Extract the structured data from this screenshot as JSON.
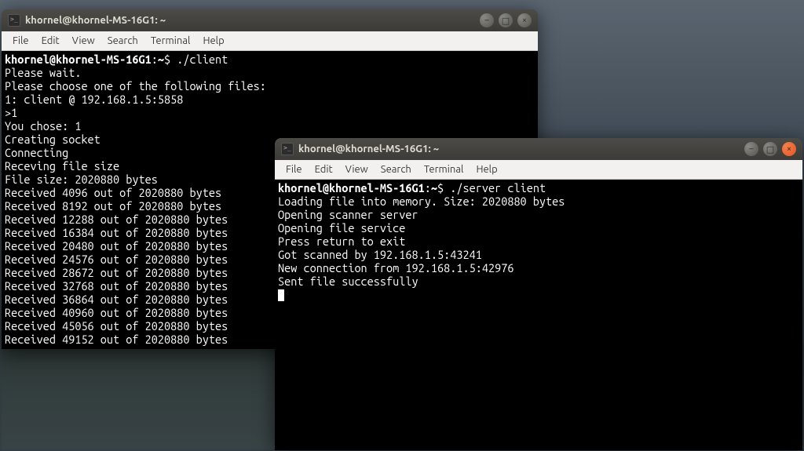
{
  "window1": {
    "title": "khornel@khornel-MS-16G1: ~",
    "menu": {
      "file": "File",
      "edit": "Edit",
      "view": "View",
      "search": "Search",
      "terminal": "Terminal",
      "help": "Help"
    },
    "prompt_user": "khornel@khornel-MS-16G1",
    "prompt_path": "~",
    "prompt_sep": ":",
    "prompt_sym": "$",
    "command": "./client",
    "lines": [
      "Please wait.",
      "Please choose one of the following files:",
      "1: client @ 192.168.1.5:5858",
      ">1",
      "You chose: 1",
      "Creating socket",
      "Connecting",
      "Receving file size",
      "File size: 2020880 bytes",
      "Received 4096 out of 2020880 bytes",
      "Received 8192 out of 2020880 bytes",
      "Received 12288 out of 2020880 bytes",
      "Received 16384 out of 2020880 bytes",
      "Received 20480 out of 2020880 bytes",
      "Received 24576 out of 2020880 bytes",
      "Received 28672 out of 2020880 bytes",
      "Received 32768 out of 2020880 bytes",
      "Received 36864 out of 2020880 bytes",
      "Received 40960 out of 2020880 bytes",
      "Received 45056 out of 2020880 bytes",
      "Received 49152 out of 2020880 bytes"
    ]
  },
  "window2": {
    "title": "khornel@khornel-MS-16G1: ~",
    "menu": {
      "file": "File",
      "edit": "Edit",
      "view": "View",
      "search": "Search",
      "terminal": "Terminal",
      "help": "Help"
    },
    "prompt_user": "khornel@khornel-MS-16G1",
    "prompt_path": "~",
    "prompt_sep": ":",
    "prompt_sym": "$",
    "command": "./server client",
    "lines": [
      "Loading file into memory. Size: 2020880 bytes",
      "Opening scanner server",
      "Opening file service",
      "Press return to exit",
      "Got scanned by 192.168.1.5:43241",
      "New connection from 192.168.1.5:42976",
      "Sent file successfully"
    ]
  },
  "icons": {
    "minimize": "–",
    "maximize": "□",
    "close": "×"
  }
}
